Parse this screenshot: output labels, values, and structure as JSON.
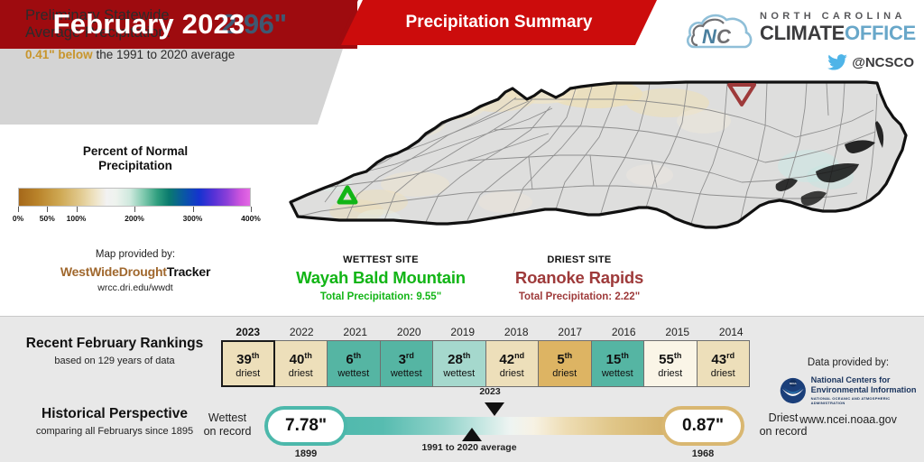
{
  "header": {
    "title": "February 2023",
    "subtitle": "Precipitation Summary",
    "logo": {
      "line1": "NORTH CAROLINA",
      "climate": "CLIMATE",
      "office": "OFFICE",
      "twitter_handle": "@NCSCO",
      "twitter_icon": "twitter-bird-icon",
      "cloud_icon": "nc-cloud-logo-icon"
    },
    "colors": {
      "dark_red": "#9e0b0f",
      "red": "#cc0c0c"
    }
  },
  "statewide": {
    "label_line1": "Preliminary Statewide",
    "label_line2": "Average Precipitation:",
    "value": "2.96\"",
    "departure": "0.41\" below",
    "departure_rest": " the 1991 to 2020 average",
    "value_color": "#3f5871",
    "departure_color": "#c8952c"
  },
  "legend": {
    "title_line1": "Percent of Normal",
    "title_line2": "Precipitation",
    "ticks": [
      "0%",
      "50%",
      "100%",
      "200%",
      "300%",
      "400%"
    ],
    "tick_positions": [
      0,
      50,
      100,
      200,
      300,
      400
    ],
    "scale_max": 400
  },
  "map_credit": {
    "line1": "Map provided by:",
    "brand_orange": "WestWideDrought",
    "brand_black": "Tracker",
    "url": "wrcc.dri.edu/wwdt"
  },
  "sites": {
    "wettest": {
      "kicker": "WETTEST SITE",
      "name": "Wayah Bald Mountain",
      "precip": "Total Precipitation: 9.55\"",
      "color": "#12b516",
      "marker_icon": "triangle-up-marker-icon"
    },
    "driest": {
      "kicker": "DRIEST SITE",
      "name": "Roanoke Rapids",
      "precip": "Total Precipitation: 2.22\"",
      "color": "#9e3a3a",
      "marker_icon": "triangle-down-marker-icon"
    }
  },
  "rankings": {
    "title": "Recent February Rankings",
    "subtitle": "based on 129 years of data",
    "rows": [
      {
        "year": "2023",
        "rank": "39",
        "suffix": "th",
        "word": "driest",
        "color": "#eddfba",
        "current": true
      },
      {
        "year": "2022",
        "rank": "40",
        "suffix": "th",
        "word": "driest",
        "color": "#eddfba",
        "current": false
      },
      {
        "year": "2021",
        "rank": "6",
        "suffix": "th",
        "word": "wettest",
        "color": "#55b5a3",
        "current": false
      },
      {
        "year": "2020",
        "rank": "3",
        "suffix": "rd",
        "word": "wettest",
        "color": "#55b5a3",
        "current": false
      },
      {
        "year": "2019",
        "rank": "28",
        "suffix": "th",
        "word": "wettest",
        "color": "#a5d8cd",
        "current": false
      },
      {
        "year": "2018",
        "rank": "42",
        "suffix": "nd",
        "word": "driest",
        "color": "#eddfba",
        "current": false
      },
      {
        "year": "2017",
        "rank": "5",
        "suffix": "th",
        "word": "driest",
        "color": "#ddb463",
        "current": false
      },
      {
        "year": "2016",
        "rank": "15",
        "suffix": "th",
        "word": "wettest",
        "color": "#55b5a3",
        "current": false
      },
      {
        "year": "2015",
        "rank": "55",
        "suffix": "th",
        "word": "driest",
        "color": "#faf5e7",
        "current": false
      },
      {
        "year": "2014",
        "rank": "43",
        "suffix": "rd",
        "word": "driest",
        "color": "#eddfba",
        "current": false
      }
    ]
  },
  "historical": {
    "title": "Historical Perspective",
    "subtitle": "comparing all Februarys since 1895",
    "wettest_label_line1": "Wettest",
    "wettest_label_line2": "on record",
    "wettest_value": "7.78\"",
    "wettest_year": "1899",
    "driest_label_line1": "Driest",
    "driest_label_line2": "on record",
    "driest_value": "0.87\"",
    "driest_year": "1968",
    "current_marker_label": "2023",
    "normal_marker_label": "1991 to 2020 average",
    "wet_color": "#4cb8ab",
    "dry_color": "#d9b771"
  },
  "data_credit": {
    "title": "Data provided by:",
    "agency_line1": "National Centers for",
    "agency_line2": "Environmental Information",
    "agency_line3": "NATIONAL OCEANIC AND ATMOSPHERIC ADMINISTRATION",
    "url": "www.ncei.noaa.gov",
    "logo_icon": "noaa-seal-icon"
  }
}
